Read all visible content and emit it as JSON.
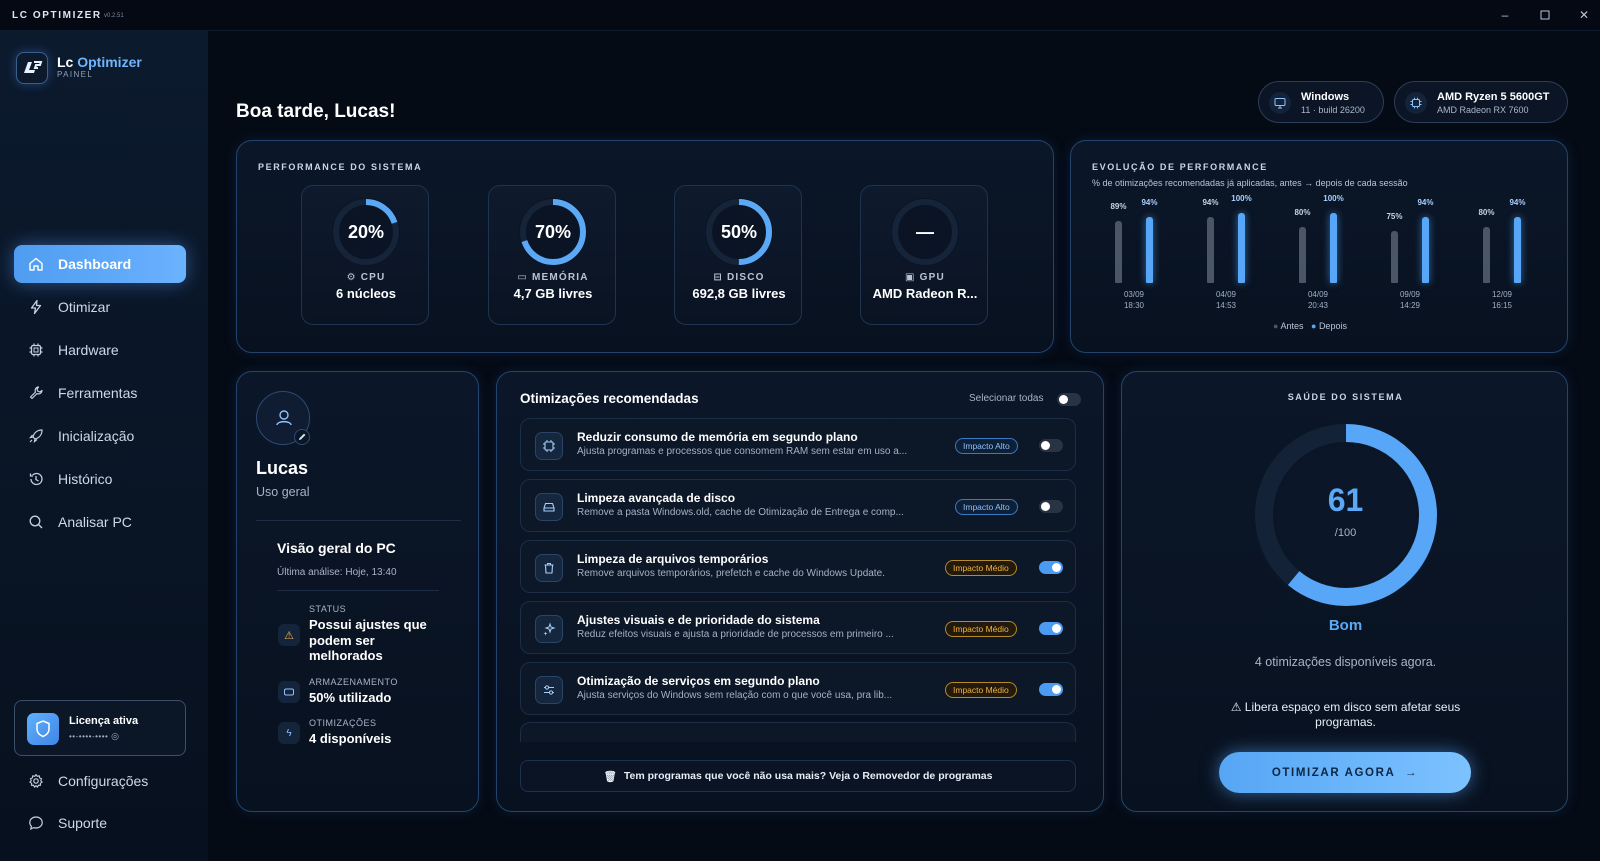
{
  "window": {
    "title": "LC OPTIMIZER",
    "version": "v0.2.51"
  },
  "brand": {
    "name_a": "Lc",
    "name_b": "Optimizer",
    "sub": "PAINEL"
  },
  "nav": [
    {
      "label": "Dashboard",
      "icon": "home-icon"
    },
    {
      "label": "Otimizar",
      "icon": "lightning-icon"
    },
    {
      "label": "Hardware",
      "icon": "chip-icon"
    },
    {
      "label": "Ferramentas",
      "icon": "wrench-icon"
    },
    {
      "label": "Inicialização",
      "icon": "rocket-icon"
    },
    {
      "label": "Histórico",
      "icon": "history-icon"
    },
    {
      "label": "Analisar PC",
      "icon": "search-icon"
    }
  ],
  "license": {
    "title": "Licença ativa",
    "key": "••-••••-••••"
  },
  "bottom_nav": [
    {
      "label": "Configurações",
      "icon": "gear-icon"
    },
    {
      "label": "Suporte",
      "icon": "chat-icon"
    }
  ],
  "greeting": "Boa tarde, Lucas!",
  "system_pills": [
    {
      "title": "Windows",
      "sub": "11 · build 26200",
      "icon": "monitor-icon"
    },
    {
      "title": "AMD Ryzen 5 5600GT",
      "sub": "AMD Radeon RX 7600",
      "icon": "cpu-icon"
    }
  ],
  "performance": {
    "title": "PERFORMANCE DO SISTEMA",
    "gauges": [
      {
        "value": "20%",
        "fraction": 0.2,
        "label": "CPU",
        "sub": "6 núcleos"
      },
      {
        "value": "70%",
        "fraction": 0.7,
        "label": "MEMÓRIA",
        "sub": "4,7 GB livres"
      },
      {
        "value": "50%",
        "fraction": 0.5,
        "label": "DISCO",
        "sub": "692,8 GB livres"
      },
      {
        "value": "—",
        "fraction": 0,
        "label": "GPU",
        "sub": "AMD Radeon R..."
      }
    ]
  },
  "chart_data": {
    "type": "bar",
    "title": "EVOLUÇÃO DE PERFORMANCE",
    "subtitle": "% de otimizações recomendadas já aplicadas, antes → depois de cada sessão",
    "categories": [
      "03/09 18:30",
      "04/09 14:53",
      "04/09 20:43",
      "09/09 14:29",
      "12/09 16:15"
    ],
    "dates": [
      "03/09",
      "04/09",
      "04/09",
      "09/09",
      "12/09"
    ],
    "times": [
      "18:30",
      "14:53",
      "20:43",
      "14:29",
      "16:15"
    ],
    "series": [
      {
        "name": "Antes",
        "values": [
          89,
          94,
          80,
          75,
          80
        ],
        "labels": [
          "89%",
          "94%",
          "80%",
          "75%",
          "80%"
        ],
        "color": "#4a5566"
      },
      {
        "name": "Depois",
        "values": [
          94,
          100,
          100,
          94,
          94
        ],
        "labels": [
          "94%",
          "100%",
          "100%",
          "94%",
          "94%"
        ],
        "color": "#58a6f7"
      }
    ],
    "ylim": [
      0,
      100
    ],
    "legend": "bottom",
    "grid": false
  },
  "profile": {
    "name": "Lucas",
    "role": "Uso geral",
    "overview_title": "Visão geral do PC",
    "last_analysis": "Última análise: Hoje, 13:40",
    "status_label": "STATUS",
    "status_value": "Possui ajustes que podem ser melhorados",
    "storage_label": "ARMAZENAMENTO",
    "storage_value": "50% utilizado",
    "opt_label": "OTIMIZAÇÕES",
    "opt_value": "4 disponíveis"
  },
  "optimizations": {
    "title": "Otimizações recomendadas",
    "select_all": "Selecionar todas",
    "items": [
      {
        "title": "Reduzir consumo de memória em segundo plano",
        "desc": "Ajusta programas e processos que consomem RAM sem estar em uso a...",
        "impact": "Impacto Alto",
        "level": "alto",
        "enabled": false,
        "icon": "memory-chip-icon"
      },
      {
        "title": "Limpeza avançada de disco",
        "desc": "Remove a pasta Windows.old, cache de Otimização de Entrega e comp...",
        "impact": "Impacto Alto",
        "level": "alto",
        "enabled": false,
        "icon": "disk-icon"
      },
      {
        "title": "Limpeza de arquivos temporários",
        "desc": "Remove arquivos temporários, prefetch e cache do Windows Update.",
        "impact": "Impacto Médio",
        "level": "medio",
        "enabled": true,
        "icon": "trash-icon"
      },
      {
        "title": "Ajustes visuais e de prioridade do sistema",
        "desc": "Reduz efeitos visuais e ajusta a prioridade de processos em primeiro ...",
        "impact": "Impacto Médio",
        "level": "medio",
        "enabled": true,
        "icon": "sparkle-icon"
      },
      {
        "title": "Otimização de serviços em segundo plano",
        "desc": "Ajusta serviços do Windows sem relação com o que você usa, pra lib...",
        "impact": "Impacto Médio",
        "level": "medio",
        "enabled": true,
        "icon": "sliders-icon"
      }
    ],
    "footer": "Tem programas que você não usa mais? Veja o Removedor de programas"
  },
  "health": {
    "title": "SAÚDE DO SISTEMA",
    "score": "61",
    "max": "/100",
    "fraction": 0.61,
    "grade": "Bom",
    "available": "4 otimizações disponíveis agora.",
    "warning": "⚠ Libera espaço em disco sem afetar seus programas.",
    "button": "OTIMIZAR AGORA",
    "accent": "#58a6f7"
  }
}
